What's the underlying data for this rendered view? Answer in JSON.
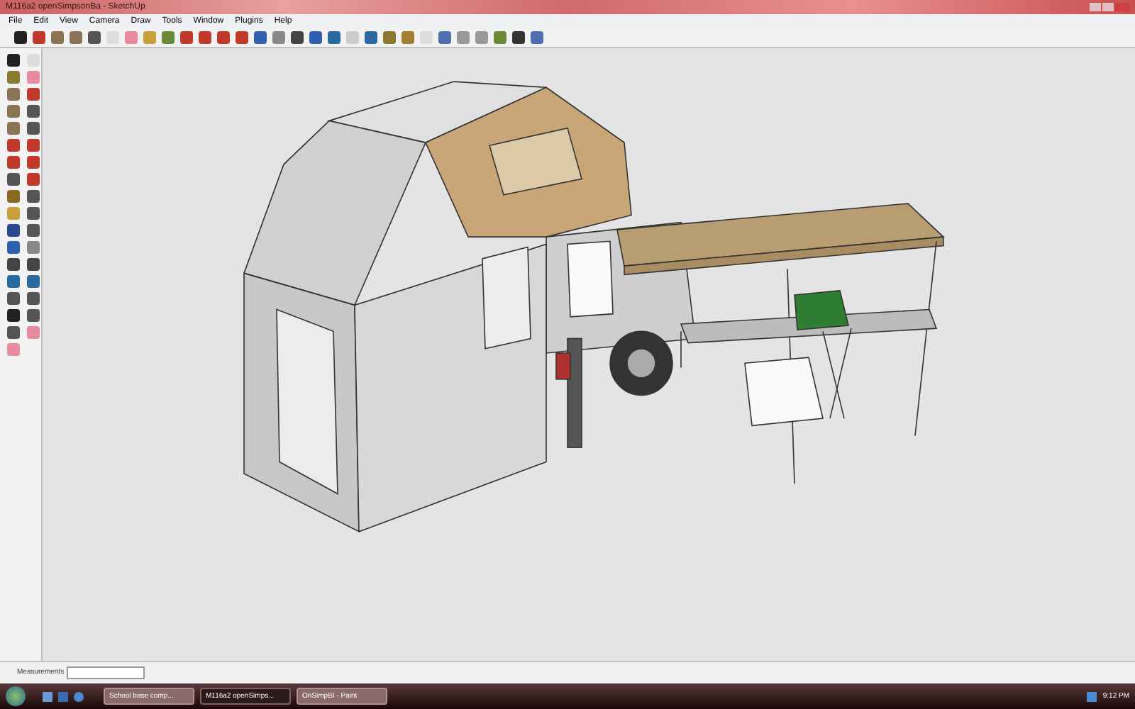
{
  "window": {
    "title": "M116a2 openSimpsonBa - SketchUp"
  },
  "menu": [
    "File",
    "Edit",
    "View",
    "Camera",
    "Draw",
    "Tools",
    "Window",
    "Plugins",
    "Help"
  ],
  "status_bar": {
    "measurements_label": "Measurements"
  },
  "taskbar": {
    "items": [
      {
        "label": "School base comp...",
        "selected": false
      },
      {
        "label": "M116a2 openSimps...",
        "selected": true
      },
      {
        "label": "OnSimpBI - Paint",
        "selected": false
      }
    ],
    "clock": "9:12 PM"
  }
}
